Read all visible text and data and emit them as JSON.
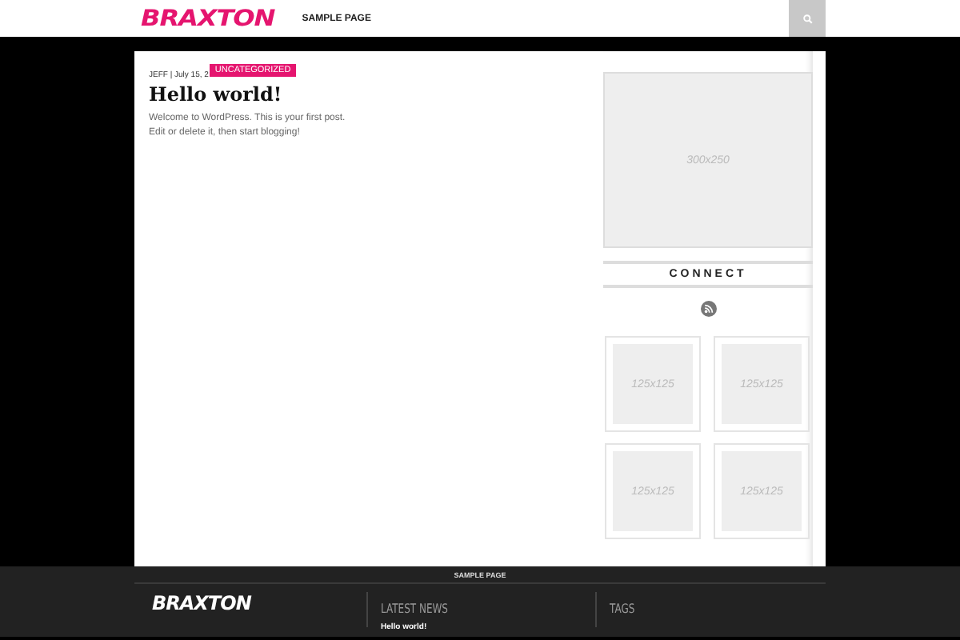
{
  "header": {
    "logo": "BRAXTON",
    "nav": [
      {
        "label": "SAMPLE PAGE"
      }
    ]
  },
  "post": {
    "meta": "JEFF | July 15, 2",
    "category": "UNCATEGORIZED",
    "title": "Hello world!",
    "excerpt": "Welcome to WordPress. This is your first post. Edit or delete it, then start blogging!"
  },
  "sidebar": {
    "ad_large": "300x250",
    "connect_title": "CONNECT",
    "ads_small": [
      "125x125",
      "125x125",
      "125x125",
      "125x125"
    ]
  },
  "footer": {
    "nav": [
      {
        "label": "SAMPLE PAGE"
      }
    ],
    "logo": "BRAXTON",
    "columns": [
      {
        "title": "LATEST NEWS",
        "items": [
          "Hello world!"
        ]
      },
      {
        "title": "TAGS"
      }
    ]
  }
}
